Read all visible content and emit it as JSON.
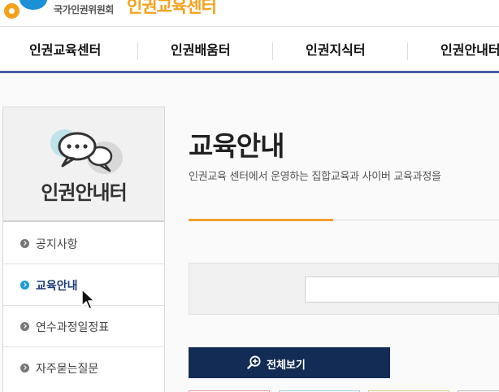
{
  "header": {
    "org_name": "국가인권위원회",
    "logo_text": "인권교육센터"
  },
  "gnb": {
    "items": [
      "인권교육센터",
      "인권배움터",
      "인권지식터",
      "인권안내터"
    ]
  },
  "lnb": {
    "title": "인권안내터",
    "items": [
      {
        "label": "공지사항",
        "active": false
      },
      {
        "label": "교육안내",
        "active": true
      },
      {
        "label": "연수과정일정표",
        "active": false
      },
      {
        "label": "자주묻는질문",
        "active": false
      }
    ]
  },
  "main": {
    "title": "교육안내",
    "description": "인권교육 센터에서 운영하는 집합교육과 사이버 교육과정을",
    "search": {
      "value": "",
      "placeholder": ""
    },
    "view_all_label": "전체보기"
  },
  "colors": {
    "gnb_bar": "#4a5aa8",
    "accent_orange": "#f0a030",
    "button_navy": "#132c55",
    "active_bullet": "#1b9ad6"
  }
}
